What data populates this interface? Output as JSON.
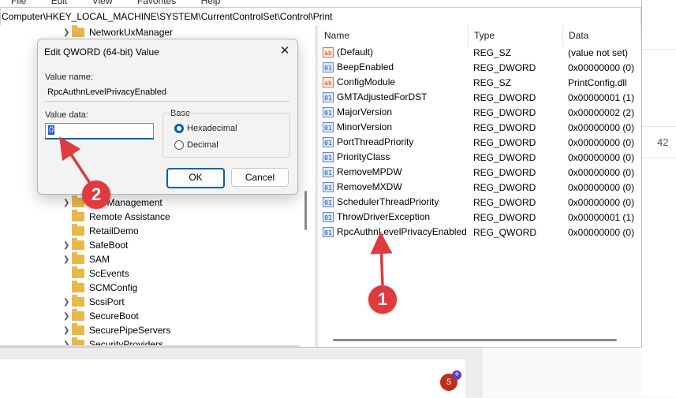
{
  "menubar": {
    "items": [
      "File",
      "Edit",
      "View",
      "Favorites",
      "Help"
    ]
  },
  "address": "Computer\\HKEY_LOCAL_MACHINE\\SYSTEM\\CurrentControlSet\\Control\\Print",
  "tree": {
    "items": [
      {
        "label": "NetworkUxManager"
      },
      {
        "label": "PnPManagement"
      },
      {
        "label": "Remote Assistance"
      },
      {
        "label": "RetailDemo"
      },
      {
        "label": "SafeBoot"
      },
      {
        "label": "SAM"
      },
      {
        "label": "ScEvents"
      },
      {
        "label": "SCMConfig"
      },
      {
        "label": "ScsiPort"
      },
      {
        "label": "SecureBoot"
      },
      {
        "label": "SecurePipeServers"
      },
      {
        "label": "SecurityProviders"
      }
    ]
  },
  "list": {
    "columns": [
      "Name",
      "Type",
      "Data"
    ],
    "rows": [
      {
        "icon": "ab",
        "name": "(Default)",
        "type": "REG_SZ",
        "data": "(value not set)"
      },
      {
        "icon": "bin",
        "name": "BeepEnabled",
        "type": "REG_DWORD",
        "data": "0x00000000 (0)"
      },
      {
        "icon": "ab",
        "name": "ConfigModule",
        "type": "REG_SZ",
        "data": "PrintConfig.dll"
      },
      {
        "icon": "bin",
        "name": "GMTAdjustedForDST",
        "type": "REG_DWORD",
        "data": "0x00000001 (1)"
      },
      {
        "icon": "bin",
        "name": "MajorVersion",
        "type": "REG_DWORD",
        "data": "0x00000002 (2)"
      },
      {
        "icon": "bin",
        "name": "MinorVersion",
        "type": "REG_DWORD",
        "data": "0x00000000 (0)"
      },
      {
        "icon": "bin",
        "name": "PortThreadPriority",
        "type": "REG_DWORD",
        "data": "0x00000000 (0)"
      },
      {
        "icon": "bin",
        "name": "PriorityClass",
        "type": "REG_DWORD",
        "data": "0x00000000 (0)"
      },
      {
        "icon": "bin",
        "name": "RemoveMPDW",
        "type": "REG_DWORD",
        "data": "0x00000000 (0)"
      },
      {
        "icon": "bin",
        "name": "RemoveMXDW",
        "type": "REG_DWORD",
        "data": "0x00000000 (0)"
      },
      {
        "icon": "bin",
        "name": "SchedulerThreadPriority",
        "type": "REG_DWORD",
        "data": "0x00000000 (0)"
      },
      {
        "icon": "bin",
        "name": "ThrowDriverException",
        "type": "REG_DWORD",
        "data": "0x00000001 (1)"
      },
      {
        "icon": "bin",
        "name": "RpcAuthnLevelPrivacyEnabled",
        "type": "REG_QWORD",
        "data": "0x00000000 (0)"
      }
    ]
  },
  "dialog": {
    "title": "Edit QWORD (64-bit) Value",
    "value_name_label": "Value name:",
    "value_name": "RpcAuthnLevelPrivacyEnabled",
    "value_data_label": "Value data:",
    "value_data": "0",
    "base_label": "Base",
    "hex_label": "Hexadecimal",
    "dec_label": "Decimal",
    "ok": "OK",
    "cancel": "Cancel",
    "close_glyph": "✕"
  },
  "annotations": {
    "marker1": "1",
    "marker2": "2",
    "color": "#e0393e"
  },
  "background": {
    "number": "42",
    "badge": "5",
    "badge_plus": "+"
  }
}
